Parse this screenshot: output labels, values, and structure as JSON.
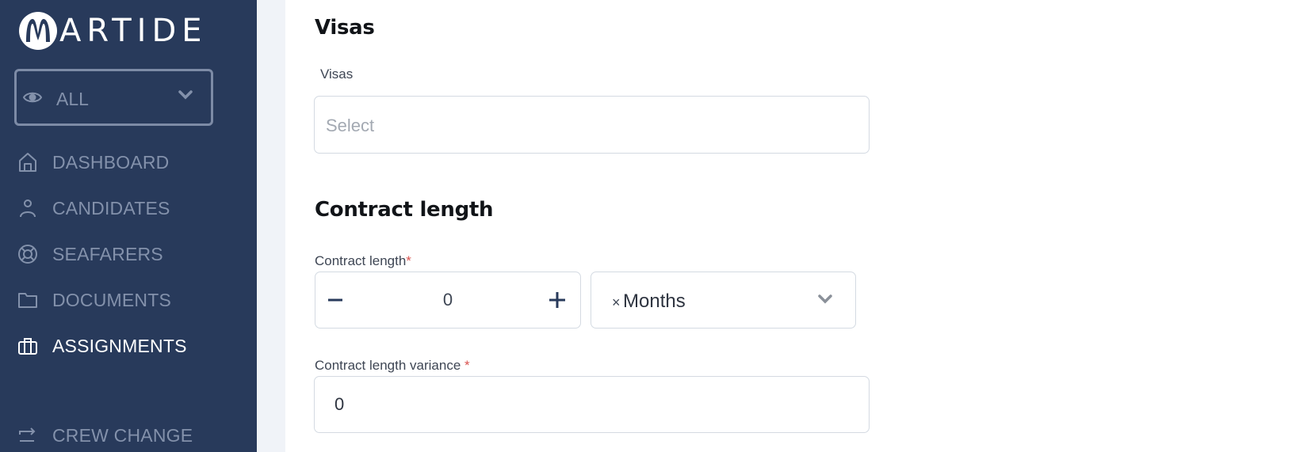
{
  "app": {
    "brand": "ARTIDE",
    "brand_initial": "M"
  },
  "sidebar": {
    "view_filter": {
      "label": "ALL",
      "icon": "eye-icon"
    },
    "items": [
      {
        "label": "DASHBOARD",
        "icon": "home-icon",
        "active": false
      },
      {
        "label": "CANDIDATES",
        "icon": "user-icon",
        "active": false
      },
      {
        "label": "SEAFARERS",
        "icon": "lifebuoy-icon",
        "active": false
      },
      {
        "label": "DOCUMENTS",
        "icon": "folder-icon",
        "active": false
      },
      {
        "label": "ASSIGNMENTS",
        "icon": "briefcase-icon",
        "active": true
      },
      {
        "label": "CREW CHANGE",
        "icon": "swap-icon",
        "active": false
      }
    ]
  },
  "form": {
    "visas_section": {
      "title": "Visas",
      "field_label": "Visas",
      "placeholder": "Select"
    },
    "contract_section": {
      "title": "Contract length",
      "length_label": "Contract length",
      "required_mark": "*",
      "length_value": "0",
      "unit_clear": "×",
      "unit_value": "Months",
      "variance_label": "Contract length variance",
      "variance_required_mark": " *",
      "variance_value": "0"
    }
  },
  "colors": {
    "sidebar_bg": "#283a5b",
    "sidebar_text": "#8391ab",
    "active_text": "#ffffff",
    "required": "#d9534f"
  }
}
